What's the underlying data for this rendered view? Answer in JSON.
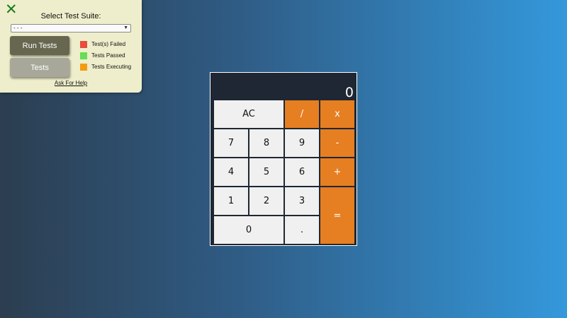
{
  "panel": {
    "close_symbol": "✕",
    "select_label": "Select Test Suite:",
    "select_value": "- - -",
    "run_button": "Run Tests",
    "tests_button": "Tests",
    "legend": [
      {
        "label": "Test(s) Failed",
        "color": "#e74c3c"
      },
      {
        "label": "Tests Passed",
        "color": "#66dd55"
      },
      {
        "label": "Tests Executing",
        "color": "#f39c12"
      }
    ],
    "help_link": "Ask For Help"
  },
  "calculator": {
    "display_value": "0",
    "keys": {
      "clear": "AC",
      "divide": "/",
      "multiply": "x",
      "seven": "7",
      "eight": "8",
      "nine": "9",
      "subtract": "-",
      "four": "4",
      "five": "5",
      "six": "6",
      "add": "+",
      "one": "1",
      "two": "2",
      "three": "3",
      "equals": "=",
      "zero": "0",
      "decimal": "."
    },
    "colors": {
      "operator": "#e67e22",
      "number": "#f0f0f0",
      "body": "#1e2733"
    }
  }
}
